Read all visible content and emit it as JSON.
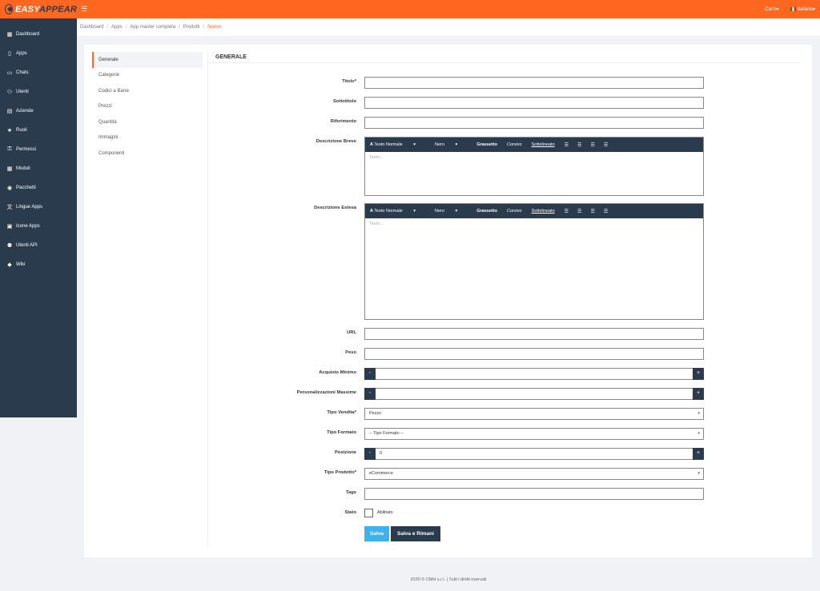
{
  "brand": {
    "name_part1": "EASY",
    "name_part2": "APPEAR"
  },
  "topbar": {
    "menu_icon": "☰",
    "user": "Carlo",
    "language": "Italiano",
    "caret": "▾"
  },
  "sidebar": {
    "items": [
      {
        "label": "Dashboard",
        "icon": "▦"
      },
      {
        "label": "Apps",
        "icon": "▯"
      },
      {
        "label": "Chats",
        "icon": "▭"
      },
      {
        "label": "Utenti",
        "icon": "⚇"
      },
      {
        "label": "Aziende",
        "icon": "▤"
      },
      {
        "label": "Ruoli",
        "icon": "★"
      },
      {
        "label": "Permessi",
        "icon": "⚿"
      },
      {
        "label": "Moduli",
        "icon": "▦"
      },
      {
        "label": "Pacchetti",
        "icon": "◉"
      },
      {
        "label": "Lingue Apps",
        "icon": "文"
      },
      {
        "label": "Icone Apps",
        "icon": "▣"
      },
      {
        "label": "Utenti API",
        "icon": "⚉"
      },
      {
        "label": "Wiki",
        "icon": "◆"
      }
    ]
  },
  "breadcrumb": {
    "items": [
      "Dashboard",
      "Apps",
      "App master completa",
      "Prodotti"
    ],
    "current": "Nuovo",
    "separator": "/"
  },
  "tabs": [
    {
      "label": "Generale"
    },
    {
      "label": "Categorie"
    },
    {
      "label": "Codici a Barre"
    },
    {
      "label": "Prezzi"
    },
    {
      "label": "Quantità"
    },
    {
      "label": "Immagini"
    },
    {
      "label": "Componenti"
    }
  ],
  "form": {
    "section_title": "GENERALE",
    "titolo_label": "Titolo*",
    "sottotitolo_label": "Sottotitolo",
    "riferimento_label": "Riferimento",
    "desc_breve_label": "Descrizione Breve",
    "desc_estesa_label": "Descrizione Estesa",
    "editor": {
      "style": "Testo Normale",
      "color": "Nero",
      "bold": "Grassetto",
      "italic": "Corsivo",
      "underline": "Sottolineato",
      "placeholder": "Testo..."
    },
    "url_label": "URL",
    "peso_label": "Peso",
    "acquisto_minimo_label": "Acquisto Minimo",
    "personalizzazioni_label": "Personalizzazioni Massime",
    "tipo_vendita_label": "Tipo Vendita*",
    "tipo_vendita_value": "Pezzo",
    "tipo_formato_label": "Tipo Formato",
    "tipo_formato_value": "-- Tipo Formato --",
    "posizione_label": "Posizione",
    "posizione_value": "0",
    "tipo_prodotto_label": "Tipo Prodotto*",
    "tipo_prodotto_value": "eCommerce",
    "tags_label": "Tags",
    "stato_label": "Stato",
    "abilitato_label": "Abilitato",
    "minus": "-",
    "plus": "+",
    "select_caret": "▾"
  },
  "buttons": {
    "save": "Salva",
    "save_stay": "Salva e Rimani"
  },
  "footer": {
    "text": "2020 © CMH s.r.l. | Tutti i diritti riservati"
  },
  "colors": {
    "accent": "#ff6620",
    "sidebar": "#2a3b4d",
    "save": "#3bb2ec"
  }
}
